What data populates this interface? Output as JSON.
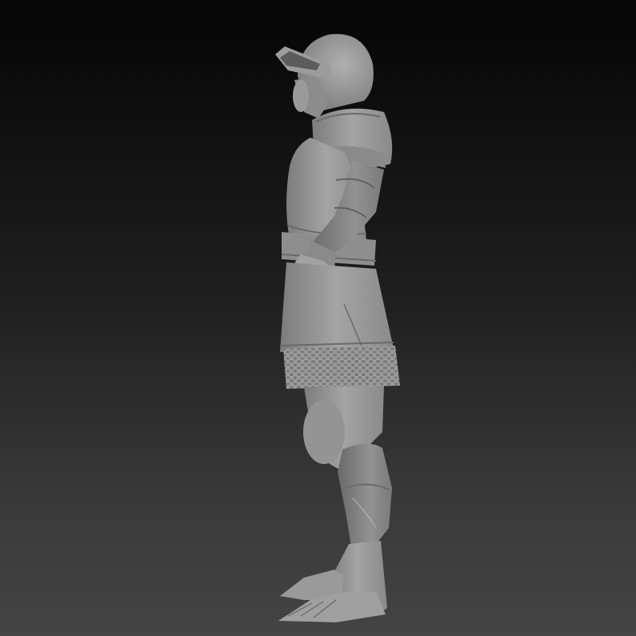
{
  "viewport": {
    "background_top": "#050505",
    "background_bottom": "#444444",
    "model_color": "#9a9a9a"
  }
}
